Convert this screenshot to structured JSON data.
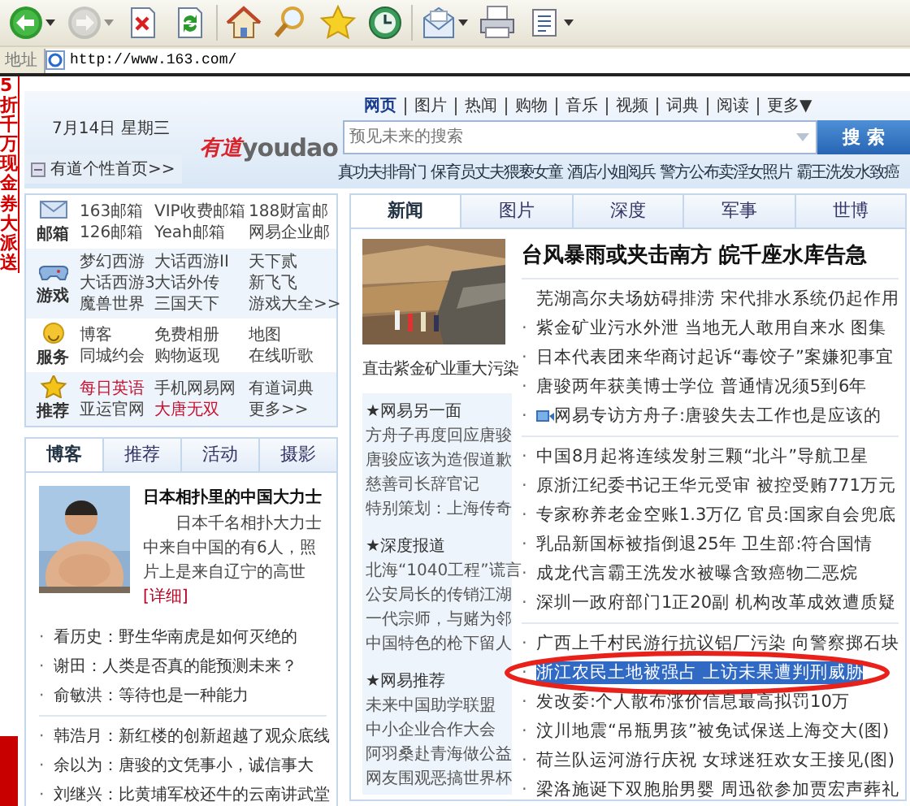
{
  "toolbar": [
    {
      "kind": "back",
      "dropdown": true,
      "disabled": false
    },
    {
      "kind": "forward",
      "dropdown": true,
      "disabled": true
    },
    {
      "kind": "stop",
      "dropdown": false,
      "disabled": false
    },
    {
      "kind": "refresh",
      "dropdown": false,
      "disabled": false
    },
    {
      "kind": "home",
      "dropdown": false,
      "disabled": false
    },
    {
      "kind": "search",
      "dropdown": false,
      "disabled": false
    },
    {
      "kind": "favorites",
      "dropdown": false,
      "disabled": false
    },
    {
      "kind": "history",
      "dropdown": false,
      "disabled": false
    },
    {
      "kind": "mail",
      "dropdown": true,
      "disabled": false
    },
    {
      "kind": "print",
      "dropdown": false,
      "disabled": false
    },
    {
      "kind": "edit",
      "dropdown": true,
      "disabled": false
    }
  ],
  "address": {
    "label": "地址",
    "url": "http://www.163.com/"
  },
  "ad": {
    "text": "5折千万现金券大派送"
  },
  "header": {
    "date": "7月14日 星期三",
    "personal_link": "有道个性首页>>",
    "logo_mark": "有道",
    "logo_word": "youdao",
    "nav": [
      {
        "label": "网页",
        "selected": true
      },
      {
        "label": "图片",
        "selected": false
      },
      {
        "label": "热闻",
        "selected": false
      },
      {
        "label": "购物",
        "selected": false
      },
      {
        "label": "音乐",
        "selected": false
      },
      {
        "label": "视频",
        "selected": false
      },
      {
        "label": "词典",
        "selected": false
      },
      {
        "label": "阅读",
        "selected": false
      },
      {
        "label": "更多▼",
        "selected": false
      }
    ],
    "search": {
      "placeholder": "预见未来的搜索",
      "button": "搜 索"
    },
    "hot_links": [
      "真功夫排骨门",
      "保育员丈夫猥亵女童",
      "酒店小姐阅兵",
      "警方公布卖淫女照片",
      "霸王洗发水致癌"
    ]
  },
  "services": [
    {
      "kind": "mail",
      "label": "邮箱",
      "links": [
        {
          "text": "163邮箱",
          "featured": false
        },
        {
          "text": "VIP收费邮箱",
          "featured": false
        },
        {
          "text": "188财富邮",
          "featured": false
        },
        {
          "text": "126邮箱",
          "featured": false
        },
        {
          "text": "Yeah邮箱",
          "featured": false
        },
        {
          "text": "网易企业邮",
          "featured": false
        }
      ]
    },
    {
      "kind": "games",
      "label": "游戏",
      "links": [
        {
          "text": "梦幻西游",
          "featured": false
        },
        {
          "text": "大话西游II",
          "featured": false
        },
        {
          "text": "天下贰",
          "featured": false
        },
        {
          "text": "大话西游3",
          "featured": false
        },
        {
          "text": "大话外传",
          "featured": false
        },
        {
          "text": "新飞飞",
          "featured": false
        },
        {
          "text": "魔兽世界",
          "featured": false
        },
        {
          "text": "三国天下",
          "featured": false
        },
        {
          "text": "游戏大全>>",
          "featured": false
        }
      ]
    },
    {
      "kind": "services",
      "label": "服务",
      "links": [
        {
          "text": "博客",
          "featured": false
        },
        {
          "text": "免费相册",
          "featured": false
        },
        {
          "text": "地图",
          "featured": false
        },
        {
          "text": "同城约会",
          "featured": false
        },
        {
          "text": "购物返现",
          "featured": false
        },
        {
          "text": "在线听歌",
          "featured": false
        }
      ]
    },
    {
      "kind": "recommend",
      "label": "推荐",
      "links": [
        {
          "text": "每日英语",
          "featured": true
        },
        {
          "text": "手机网易网",
          "featured": false
        },
        {
          "text": "有道词典",
          "featured": false
        },
        {
          "text": "亚运官网",
          "featured": false
        },
        {
          "text": "大唐无双",
          "featured": true
        },
        {
          "text": "更多>>",
          "featured": false
        }
      ]
    }
  ],
  "blog": {
    "tabs": [
      {
        "label": "博客",
        "selected": true
      },
      {
        "label": "推荐",
        "selected": false
      },
      {
        "label": "活动",
        "selected": false
      },
      {
        "label": "摄影",
        "selected": false
      }
    ],
    "feature": {
      "title": "日本相扑里的中国大力士",
      "text": "日本千名相扑大力士中来自中国的有6人，照片上是来自辽宁的高世",
      "link": "[详细]"
    },
    "groups": [
      [
        {
          "bullet": "·",
          "text": "看历史：野生华南虎是如何灭绝的"
        },
        {
          "bullet": "·",
          "text": "谢田：人类是否真的能预测未来？"
        },
        {
          "bullet": "·",
          "text": "俞敏洪：等待也是一种能力"
        }
      ],
      [
        {
          "bullet": "·",
          "text": "韩浩月：新红楼的创新超越了观众底线"
        },
        {
          "bullet": "·",
          "text": "余以为：唐骏的文凭事小，诚信事大"
        },
        {
          "bullet": "·",
          "text": "刘继兴：比黄埔军校还牛的云南讲武堂"
        }
      ]
    ]
  },
  "news": {
    "tabs": [
      {
        "label": "新闻",
        "selected": true
      },
      {
        "label": "图片",
        "selected": false
      },
      {
        "label": "深度",
        "selected": false
      },
      {
        "label": "军事",
        "selected": false
      },
      {
        "label": "世博",
        "selected": false
      }
    ],
    "photo_caption": "直击紫金矿业重大污染",
    "side_sections": [
      {
        "title": "★网易另一面",
        "links": [
          "方舟子再度回应唐骏",
          "唐骏应该为造假道歉",
          "慈善司长辞官记",
          "特别策划：上海传奇"
        ]
      },
      {
        "title": "★深度报道",
        "links": [
          "北海“1040工程”谎言",
          "公安局长的传销江湖",
          "一代宗师，与赌为邻",
          "中国特色的枪下留人"
        ]
      },
      {
        "title": "★网易推荐",
        "links": [
          "未来中国助学联盟",
          "中小企业合作大会",
          "阿羽桑赴青海做公益",
          "网友围观恶搞世界杯"
        ]
      }
    ],
    "headline": "台风暴雨或夹击南方 皖千座水库告急",
    "groups": [
      [
        {
          "text": "芜湖高尔夫场妨碍排涝 宋代排水系统仍起作用",
          "video": false
        },
        {
          "bullet": "·",
          "text": "紫金矿业污水外泄 当地无人敢用自来水 图集",
          "video": false
        },
        {
          "bullet": "·",
          "text": "日本代表团来华商讨起诉“毒饺子”案嫌犯事宜",
          "video": false
        },
        {
          "bullet": "·",
          "text": "唐骏两年获美博士学位 普通情况须5到6年",
          "video": false
        },
        {
          "bullet": "·",
          "text": "网易专访方舟子:唐骏失去工作也是应该的",
          "video": true
        }
      ],
      [
        {
          "bullet": "·",
          "text": "中国8月起将连续发射三颗“北斗”导航卫星"
        },
        {
          "bullet": "·",
          "text": "原浙江纪委书记王华元受审 被控受贿771万元"
        },
        {
          "bullet": "·",
          "text": "专家称养老金空账1.3万亿 官员:国家自会兜底"
        },
        {
          "bullet": "·",
          "text": "乳品新国标被指倒退25年 卫生部:符合国情"
        },
        {
          "bullet": "·",
          "text": "成龙代言霸王洗发水被曝含致癌物二恶烷"
        },
        {
          "bullet": "·",
          "text": "深圳一政府部门1正20副 机构改革成效遭质疑"
        }
      ],
      [
        {
          "bullet": "·",
          "text": "广西上千村民游行抗议铝厂污染 向警察掷石块",
          "highlighted": false,
          "circled": false
        },
        {
          "bullet": "·",
          "text": "浙江农民土地被强占 上访未果遭判刑威胁",
          "highlighted": true,
          "circled": true
        },
        {
          "bullet": "·",
          "text": "发改委:个人散布涨价信息最高拟罚10万",
          "highlighted": false,
          "circled": false
        },
        {
          "bullet": "·",
          "text": "汶川地震“吊瓶男孩”被免试保送上海交大(图)",
          "highlighted": false,
          "circled": false
        },
        {
          "bullet": "·",
          "text": "荷兰队运河游行庆祝 女球迷狂欢女王接见(图)",
          "highlighted": false,
          "circled": false
        },
        {
          "bullet": "·",
          "text": "梁洛施诞下双胞胎男婴 周迅欲参加贾宏声葬礼",
          "highlighted": false,
          "circled": false
        }
      ]
    ]
  }
}
